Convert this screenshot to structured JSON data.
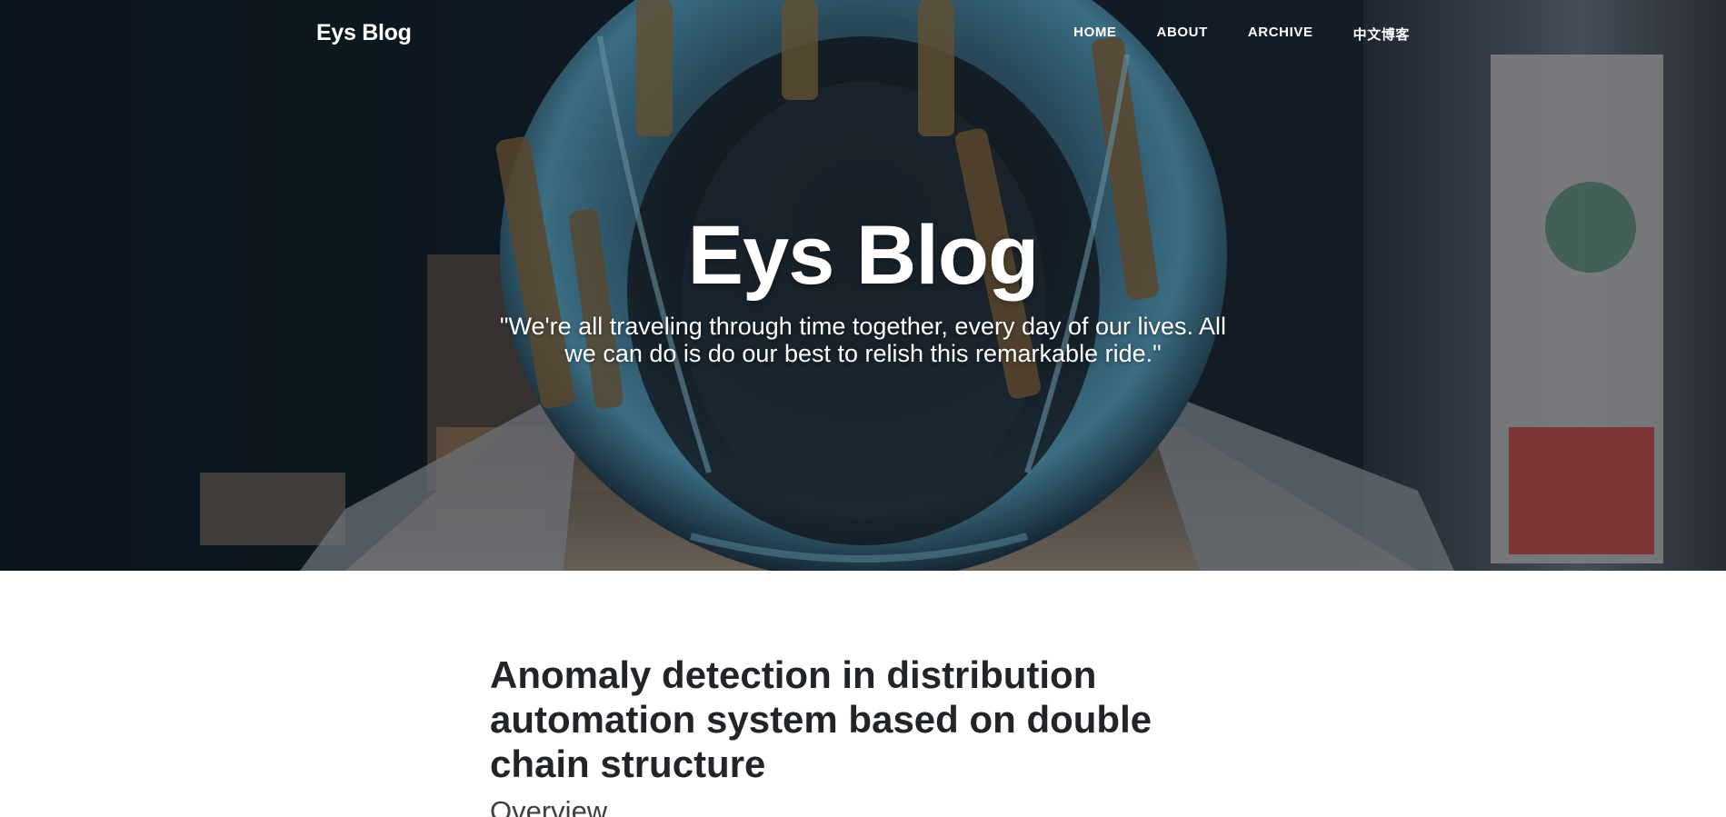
{
  "nav": {
    "brand": "Eys Blog",
    "links": [
      {
        "label": "HOME"
      },
      {
        "label": "ABOUT"
      },
      {
        "label": "ARCHIVE"
      },
      {
        "label": "中文博客"
      }
    ]
  },
  "hero": {
    "title": "Eys Blog",
    "subtitle": "\"We're all traveling through time together, every day of our lives. All we can do is do our best to relish this remarkable ride.\"",
    "image": "robot-head-photo"
  },
  "post": {
    "title": "Anomaly detection in distribution automation system based on double chain structure",
    "subtitle": "Overview"
  },
  "colors": {
    "hero_overlay": "#0a0e14",
    "heading_text": "#212529",
    "nav_text": "#ffffff"
  }
}
